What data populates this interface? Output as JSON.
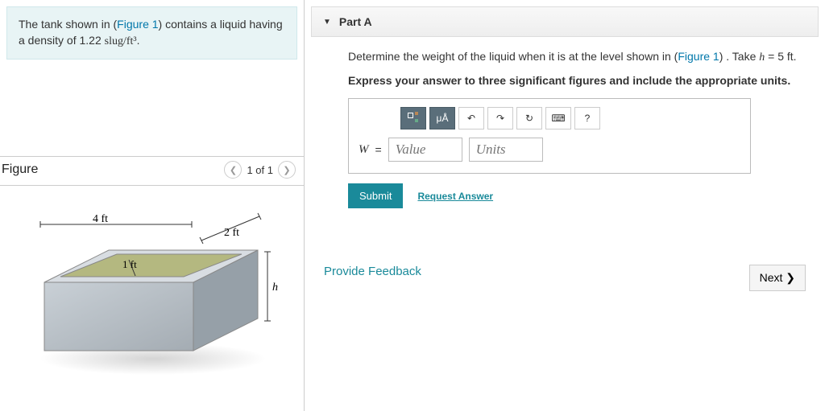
{
  "problem": {
    "text_pre": "The tank shown in (",
    "fig_label": "Figure 1",
    "text_mid": ") contains a liquid having a density of 1.22 ",
    "unit": "slug/ft³",
    "text_post": "."
  },
  "figure": {
    "title": "Figure",
    "pager": "1 of 1",
    "dims": {
      "w": "4 ft",
      "d": "2 ft",
      "inner": "1 ft",
      "h": "h"
    }
  },
  "part": {
    "label": "Part A"
  },
  "question": {
    "pre": "Determine the weight of the liquid when it is at the level shown in (",
    "fig_label": "Figure 1",
    "mid": ") . Take ",
    "hvar": "h",
    "eq": " = 5 ft.",
    "instr": "Express your answer to three significant figures and include the appropriate units."
  },
  "toolbar": {
    "mu": "μÅ",
    "undo": "↶",
    "redo": "↷",
    "reset": "↻",
    "kb": "⌨",
    "help": "?"
  },
  "answer": {
    "var": "W",
    "eq": "=",
    "value_ph": "Value",
    "units_ph": "Units"
  },
  "buttons": {
    "submit": "Submit",
    "request": "Request Answer",
    "feedback": "Provide Feedback",
    "next": "Next ❯"
  }
}
